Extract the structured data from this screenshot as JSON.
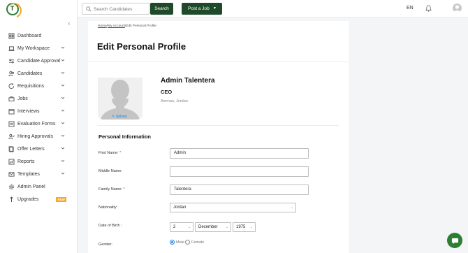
{
  "sidebar": {
    "items": [
      {
        "label": "Dashboard",
        "icon": "dashboard-icon",
        "active": true,
        "expandable": false
      },
      {
        "label": "My Workspace",
        "icon": "laptop-icon",
        "expandable": true
      },
      {
        "label": "Candidate Approval",
        "icon": "approval-icon",
        "expandable": true
      },
      {
        "label": "Candidates",
        "icon": "users-icon",
        "expandable": true
      },
      {
        "label": "Requisitions",
        "icon": "refresh-icon",
        "expandable": true
      },
      {
        "label": "Jobs",
        "icon": "briefcase-icon",
        "expandable": true
      },
      {
        "label": "Interviews",
        "icon": "calendar-icon",
        "expandable": true
      },
      {
        "label": "Evaluation Forms",
        "icon": "form-icon",
        "expandable": true
      },
      {
        "label": "Hiring Approvals",
        "icon": "user-check-icon",
        "expandable": true
      },
      {
        "label": "Offer Letters",
        "icon": "document-icon",
        "expandable": true
      },
      {
        "label": "Reports",
        "icon": "chart-icon",
        "expandable": true
      },
      {
        "label": "Templates",
        "icon": "mail-icon",
        "expandable": true
      },
      {
        "label": "Admin Panel",
        "icon": "gear-icon",
        "expandable": false
      },
      {
        "label": "Upgrades",
        "icon": "upgrade-icon",
        "expandable": false,
        "badge": "NEW"
      }
    ]
  },
  "topbar": {
    "search_placeholder": "Search Candidates",
    "search_button": "Search",
    "post_job_button": "Post a Job",
    "language": "EN"
  },
  "breadcrumb": {
    "home": "Home",
    "sep1": "/",
    "account": "My Account",
    "sep2": "/",
    "current": "Edit Personal Profile"
  },
  "page": {
    "title": "Edit Personal Profile"
  },
  "profile": {
    "name": "Admin Talentera",
    "role": "CEO",
    "location": "Amman, Jordan",
    "upload_label": "Upload"
  },
  "personal_info": {
    "section_title": "Personal Information",
    "first_name_label": "First Name:",
    "first_name_value": "Admin",
    "middle_name_label": "Middle Name:",
    "middle_name_value": "",
    "family_name_label": "Family Name:",
    "family_name_value": "Talentera",
    "nationality_label": "Nationality:",
    "nationality_value": "Jordan",
    "dob_label": "Date of Birth :",
    "dob_day": "2",
    "dob_month": "December",
    "dob_year": "1975",
    "gender_label": "Gender:",
    "gender_male": "Male",
    "gender_female": "Female",
    "gender_selected": "Male",
    "required_mark": "*"
  },
  "colors": {
    "primary_dark_green": "#1f4a2a",
    "accent_green": "#2e7d32",
    "logo_orange": "#f4a623",
    "link_blue": "#1e88e5",
    "required_red": "#d32f2f"
  }
}
